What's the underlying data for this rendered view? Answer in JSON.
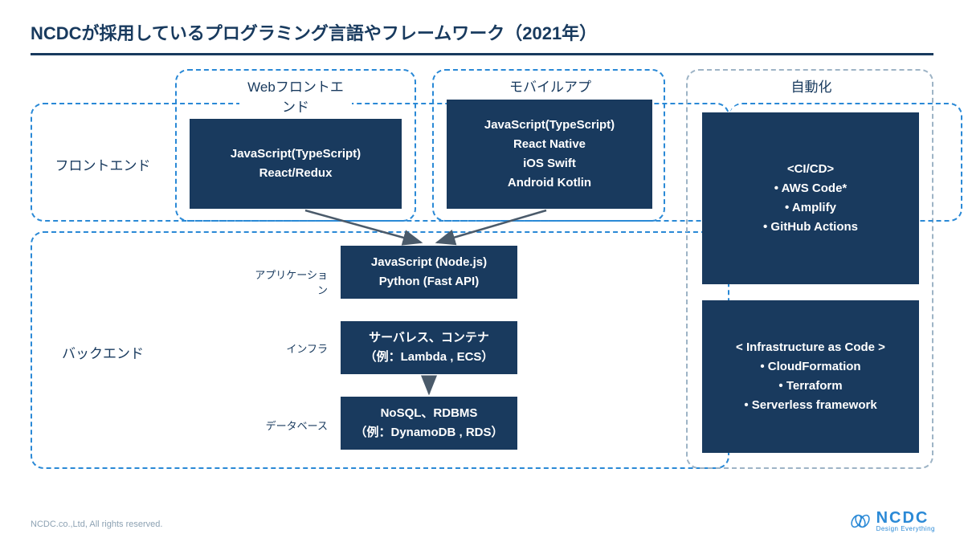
{
  "title": "NCDCが採用しているプログラミング言語やフレームワーク（2021年）",
  "columns": {
    "web": "Webフロントエンド",
    "mobile": "モバイルアプリ",
    "automation": "自動化"
  },
  "rows": {
    "frontend": "フロントエンド",
    "backend": "バックエンド"
  },
  "sublabels": {
    "app": "アプリケーション",
    "infra": "インフラ",
    "db": "データベース"
  },
  "cards": {
    "web_frontend": {
      "l1": "JavaScript(TypeScript)",
      "l2": "React/Redux"
    },
    "mobile_frontend": {
      "l1": "JavaScript(TypeScript)",
      "l2": "React Native",
      "l3": "iOS Swift",
      "l4": "Android Kotlin"
    },
    "app": {
      "l1": "JavaScript (Node.js)",
      "l2": "Python (Fast API)"
    },
    "infra": {
      "l1": "サーバレス、コンテナ",
      "l2": "（例：Lambda , ECS）"
    },
    "db": {
      "l1": "NoSQL、RDBMS",
      "l2": "（例：DynamoDB , RDS）"
    },
    "cicd": {
      "heading": "<CI/CD>",
      "i1": "AWS Code*",
      "i2": "Amplify",
      "i3": "GitHub Actions"
    },
    "iac": {
      "heading": "< Infrastructure as Code >",
      "i1": "CloudFormation",
      "i2": "Terraform",
      "i3": "Serverless framework"
    }
  },
  "footer": "NCDC.co.,Ltd, All rights reserved.",
  "logo": {
    "name": "NCDC",
    "tagline": "Design Everything"
  }
}
